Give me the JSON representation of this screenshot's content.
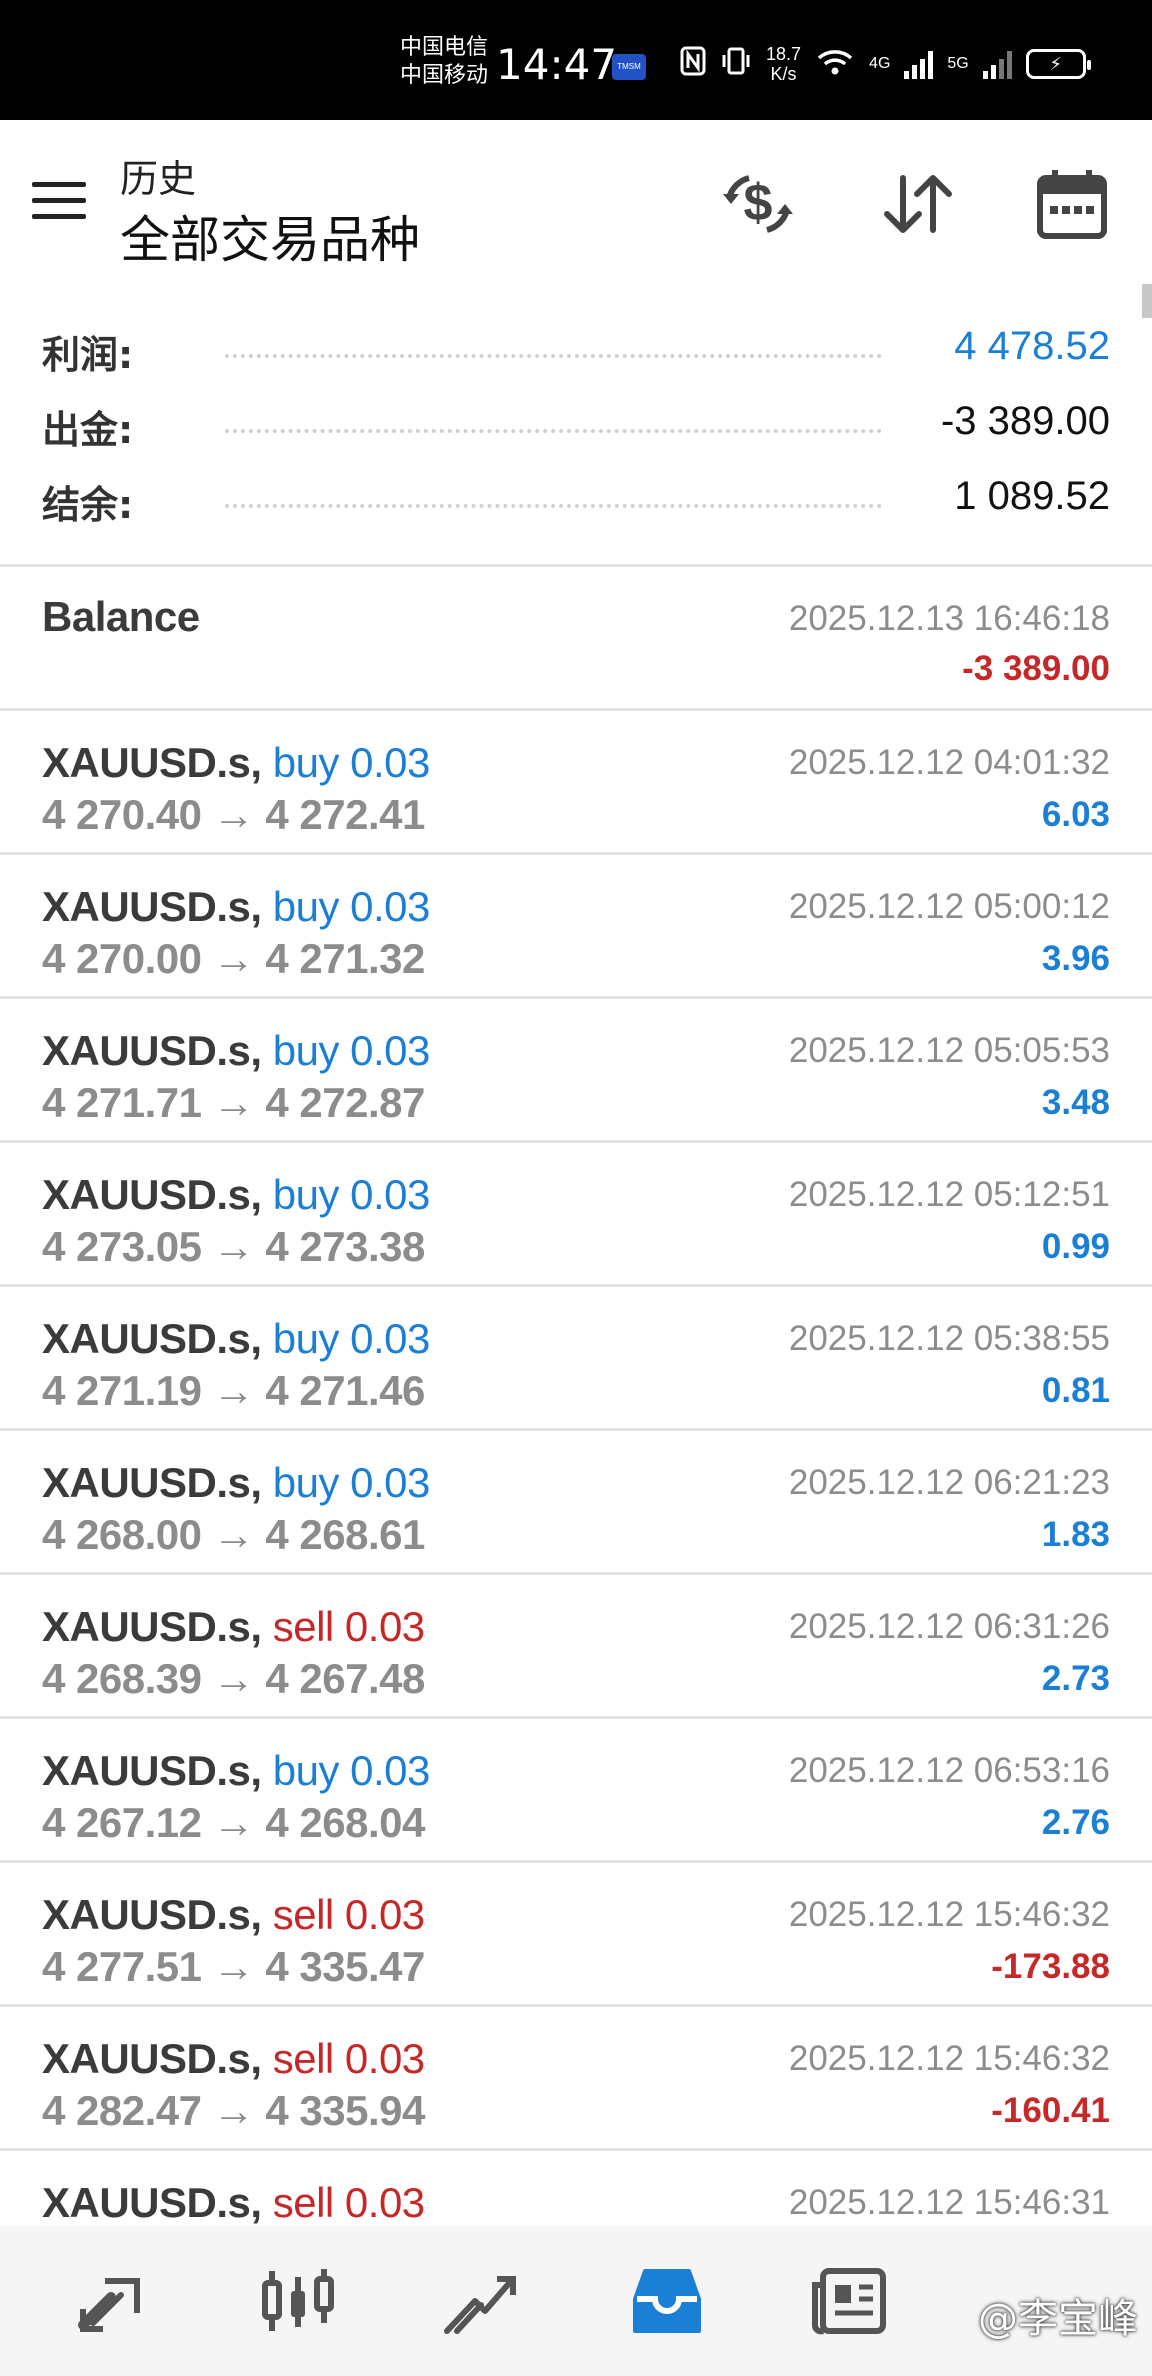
{
  "status_bar": {
    "carrier_1": "中国电信",
    "carrier_2": "中国移动",
    "time": "14:47",
    "badge": "TMSM",
    "speed_value": "18.7",
    "speed_unit": "K/s",
    "net_4g": "4G",
    "net_5g": "5G"
  },
  "header": {
    "title": "历史",
    "subtitle": "全部交易品种",
    "icons": [
      "currency-exchange-icon",
      "sort-icon",
      "calendar-icon"
    ]
  },
  "summary": [
    {
      "label": "利润:",
      "value": "4 478.52",
      "color": "#1c7fd6"
    },
    {
      "label": "出金:",
      "value": "-3 389.00",
      "color": "#111111"
    },
    {
      "label": "结余:",
      "value": "1 089.52",
      "color": "#111111"
    }
  ],
  "balance_entry": {
    "title": "Balance",
    "time": "2025.12.13 16:46:18",
    "amount": "-3 389.00"
  },
  "trades": [
    {
      "symbol": "XAUUSD.s,",
      "side": "buy 0.03",
      "type": "buy",
      "open": "4 270.40",
      "close": "4 272.41",
      "time": "2025.12.12 04:01:32",
      "profit": "6.03"
    },
    {
      "symbol": "XAUUSD.s,",
      "side": "buy 0.03",
      "type": "buy",
      "open": "4 270.00",
      "close": "4 271.32",
      "time": "2025.12.12 05:00:12",
      "profit": "3.96"
    },
    {
      "symbol": "XAUUSD.s,",
      "side": "buy 0.03",
      "type": "buy",
      "open": "4 271.71",
      "close": "4 272.87",
      "time": "2025.12.12 05:05:53",
      "profit": "3.48"
    },
    {
      "symbol": "XAUUSD.s,",
      "side": "buy 0.03",
      "type": "buy",
      "open": "4 273.05",
      "close": "4 273.38",
      "time": "2025.12.12 05:12:51",
      "profit": "0.99"
    },
    {
      "symbol": "XAUUSD.s,",
      "side": "buy 0.03",
      "type": "buy",
      "open": "4 271.19",
      "close": "4 271.46",
      "time": "2025.12.12 05:38:55",
      "profit": "0.81"
    },
    {
      "symbol": "XAUUSD.s,",
      "side": "buy 0.03",
      "type": "buy",
      "open": "4 268.00",
      "close": "4 268.61",
      "time": "2025.12.12 06:21:23",
      "profit": "1.83"
    },
    {
      "symbol": "XAUUSD.s,",
      "side": "sell 0.03",
      "type": "sell",
      "open": "4 268.39",
      "close": "4 267.48",
      "time": "2025.12.12 06:31:26",
      "profit": "2.73"
    },
    {
      "symbol": "XAUUSD.s,",
      "side": "buy 0.03",
      "type": "buy",
      "open": "4 267.12",
      "close": "4 268.04",
      "time": "2025.12.12 06:53:16",
      "profit": "2.76"
    },
    {
      "symbol": "XAUUSD.s,",
      "side": "sell 0.03",
      "type": "sell",
      "open": "4 277.51",
      "close": "4 335.47",
      "time": "2025.12.12 15:46:32",
      "profit": "-173.88"
    },
    {
      "symbol": "XAUUSD.s,",
      "side": "sell 0.03",
      "type": "sell",
      "open": "4 282.47",
      "close": "4 335.94",
      "time": "2025.12.12 15:46:32",
      "profit": "-160.41"
    },
    {
      "symbol": "XAUUSD.s,",
      "side": "sell 0.03",
      "type": "sell",
      "open": "",
      "close": "",
      "time": "2025.12.12 15:46:31",
      "profit": ""
    }
  ],
  "bottom_nav": {
    "items": [
      "quotes-icon",
      "chart-icon",
      "trade-icon",
      "history-icon",
      "news-icon"
    ],
    "active": "history-icon",
    "watermark": "@李宝峰"
  },
  "colors": {
    "accent": "#1c7fd6",
    "negative": "#c62828",
    "muted": "#8c8c8c"
  }
}
